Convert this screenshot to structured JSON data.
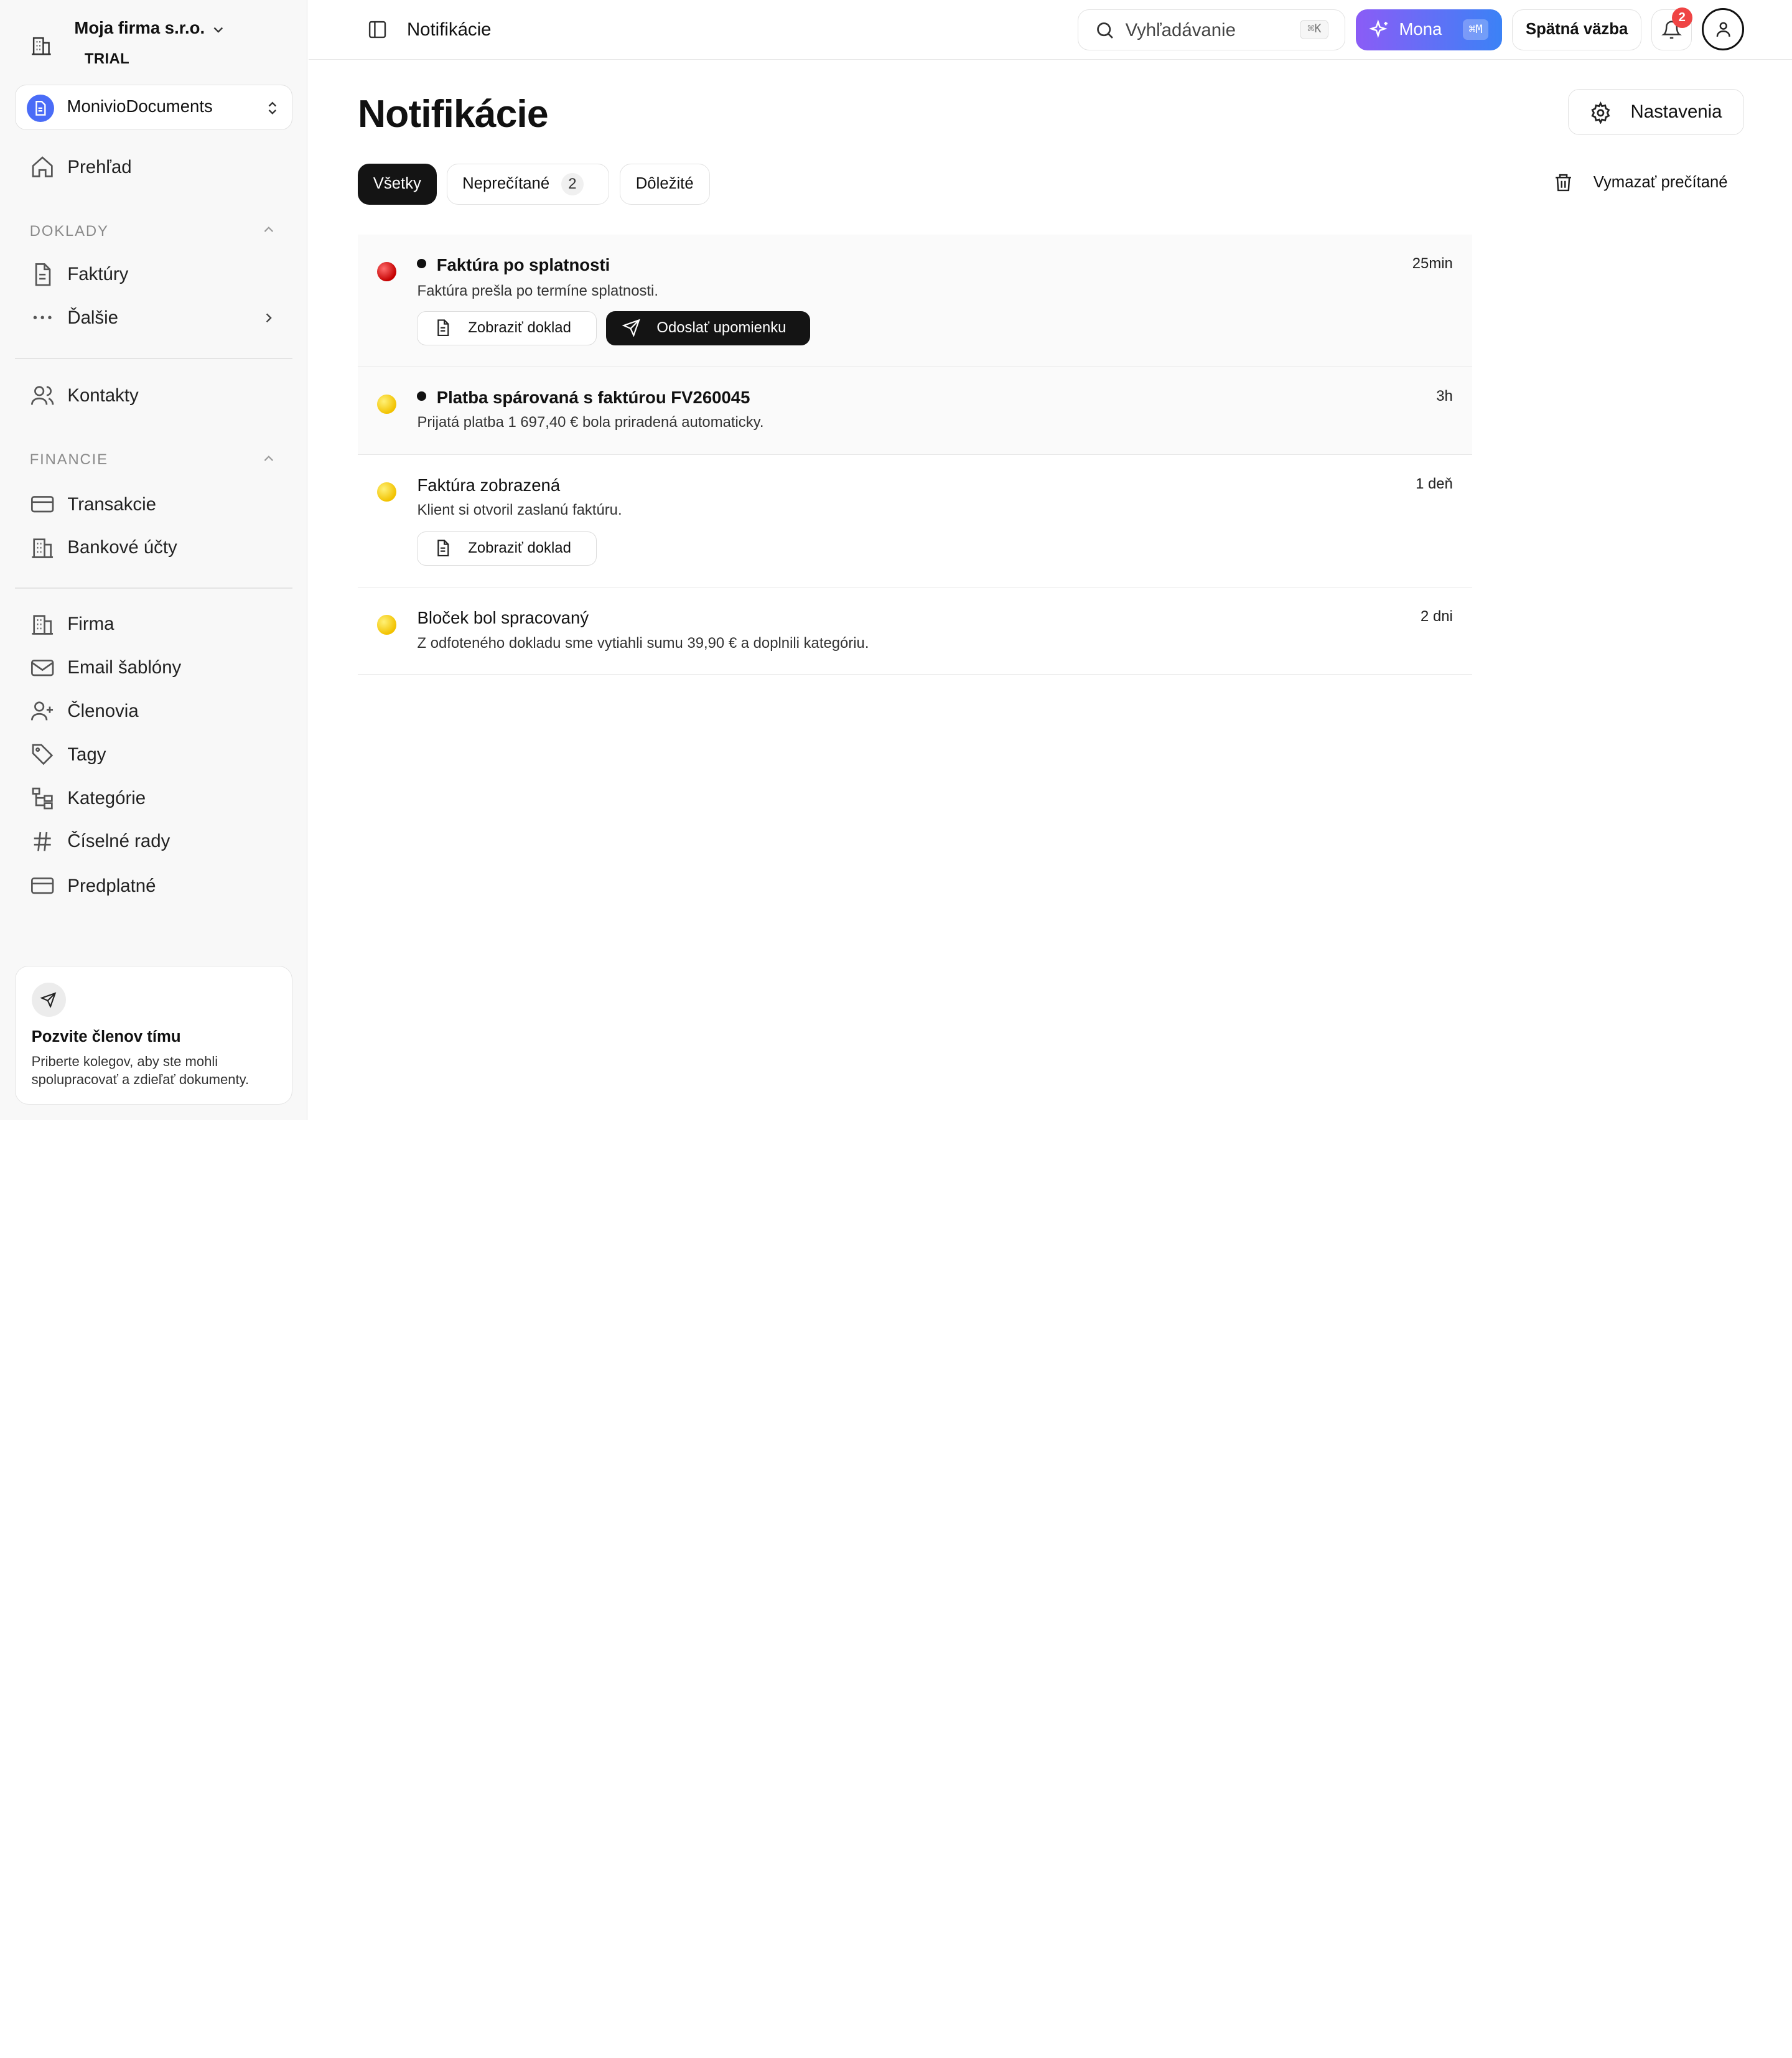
{
  "company": {
    "name": "Moja firma s.r.o.",
    "plan": "TRIAL"
  },
  "app_switcher": {
    "label": "MonivioDocuments"
  },
  "sidebar": {
    "overview": "Prehľad",
    "section_doklady": "DOKLADY",
    "invoices": "Faktúry",
    "more": "Ďalšie",
    "contacts": "Kontakty",
    "section_financie": "FINANCIE",
    "transactions": "Transakcie",
    "bank_accounts": "Bankové účty",
    "firm": "Firma",
    "email_templates": "Email šablóny",
    "members": "Členovia",
    "tags": "Tagy",
    "categories": "Kategórie",
    "number_series": "Číselné rady",
    "subscription": "Predplatné"
  },
  "invite": {
    "title": "Pozvite členov tímu",
    "desc": "Priberte kolegov, aby ste mohli spolupracovať a zdieľať dokumenty."
  },
  "topbar": {
    "breadcrumb": "Notifikácie",
    "search_placeholder": "Vyhľadávanie",
    "search_shortcut": "⌘K",
    "mona_label": "Mona",
    "mona_shortcut": "⌘M",
    "feedback": "Spätná väzba",
    "notif_count": "2"
  },
  "page": {
    "title": "Notifikácie",
    "settings": "Nastavenia",
    "clear_read": "Vymazať prečítané",
    "tabs": [
      {
        "label": "Všetky",
        "active": true
      },
      {
        "label": "Neprečítané",
        "count": "2"
      },
      {
        "label": "Dôležité"
      }
    ]
  },
  "notifications": [
    {
      "title": "Faktúra po splatnosti",
      "subtitle": "Faktúra prešla po termíne splatnosti.",
      "time": "25min",
      "status_color": "#d40000",
      "unread": true,
      "actions": [
        "Zobraziť doklad",
        "Odoslať upomienku"
      ]
    },
    {
      "title": "Platba spárovaná s faktúrou FV260045",
      "subtitle": "Prijatá platba 1 697,40 € bola priradená automaticky.",
      "time": "3h",
      "status_color": "#f2c200",
      "unread": true
    },
    {
      "title": "Faktúra zobrazená",
      "subtitle": "Klient si otvoril zaslanú faktúru.",
      "time": "1 deň",
      "status_color": "#f2c200",
      "unread": false,
      "actions": [
        "Zobraziť doklad"
      ]
    },
    {
      "title": "Bloček bol spracovaný",
      "subtitle": "Z odfoteného dokladu sme vytiahli sumu 39,90 € a doplnili kategóriu.",
      "time": "2 dni",
      "status_color": "#f2c200",
      "unread": false
    }
  ]
}
